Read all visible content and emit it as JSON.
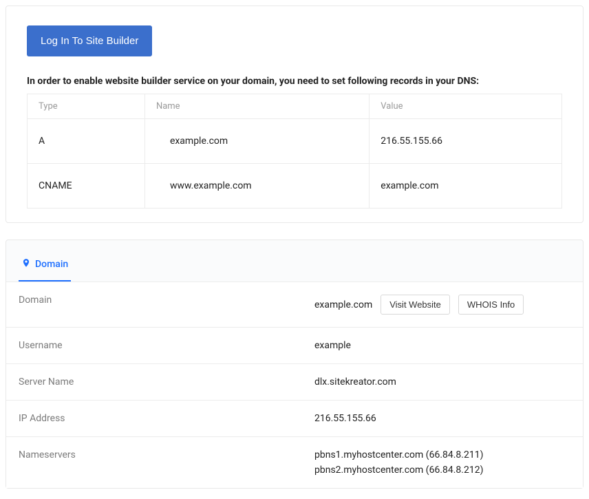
{
  "site_builder": {
    "login_button": "Log In To Site Builder",
    "instruction": "In order to enable website builder service on your domain, you need to set following records in your DNS:",
    "dns_table": {
      "headers": {
        "type": "Type",
        "name": "Name",
        "value": "Value"
      },
      "rows": [
        {
          "type": "A",
          "name": "example.com",
          "value": "216.55.155.66"
        },
        {
          "type": "CNAME",
          "name": "www.example.com",
          "value": "example.com"
        }
      ]
    }
  },
  "domain_panel": {
    "tab_label": "Domain",
    "rows": {
      "domain": {
        "label": "Domain",
        "value": "example.com",
        "visit_button": "Visit Website",
        "whois_button": "WHOIS Info"
      },
      "username": {
        "label": "Username",
        "value": "example"
      },
      "server_name": {
        "label": "Server Name",
        "value": "dlx.sitekreator.com"
      },
      "ip_address": {
        "label": "IP Address",
        "value": "216.55.155.66"
      },
      "nameservers": {
        "label": "Nameservers",
        "values": [
          "pbns1.myhostcenter.com (66.84.8.211)",
          "pbns2.myhostcenter.com (66.84.8.212)"
        ]
      }
    }
  }
}
